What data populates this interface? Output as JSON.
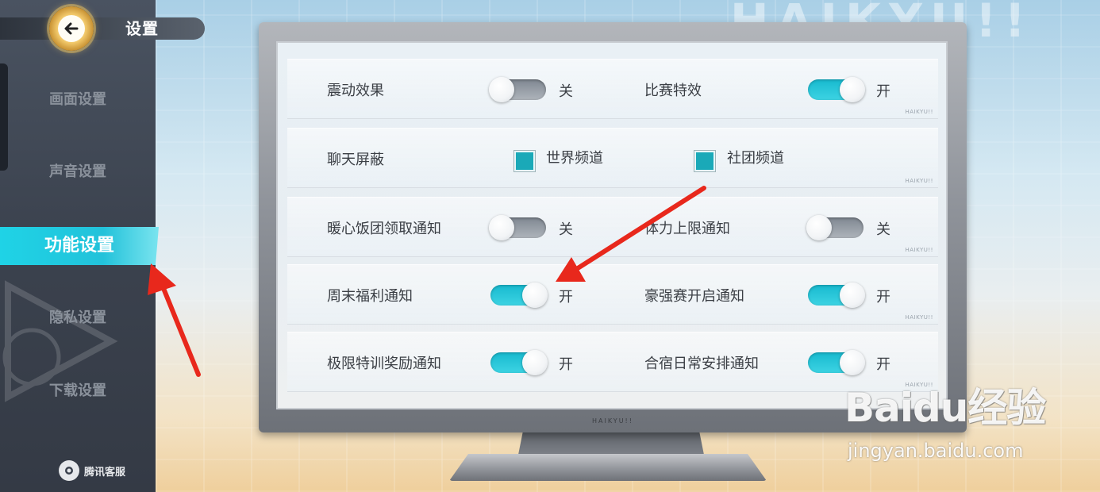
{
  "header": {
    "title": "设置",
    "back_icon": "back-arrow-icon"
  },
  "sidebar": {
    "items": [
      {
        "label": "画面设置",
        "active": false
      },
      {
        "label": "声音设置",
        "active": false
      },
      {
        "label": "功能设置",
        "active": true
      },
      {
        "label": "隐私设置",
        "active": false
      },
      {
        "label": "下载设置",
        "active": false
      }
    ],
    "support_label": "腾讯客服"
  },
  "brand_mark": "HAIKYU!!",
  "settings": {
    "rows": [
      {
        "left": {
          "label": "震动效果",
          "control": "toggle",
          "on": false,
          "state": "关"
        },
        "right": {
          "label": "比赛特效",
          "control": "toggle",
          "on": true,
          "state": "开"
        }
      },
      {
        "left": {
          "label": "聊天屏蔽",
          "control": "none"
        },
        "options": [
          {
            "label": "世界频道",
            "checked": true
          },
          {
            "label": "社团频道",
            "checked": true
          }
        ]
      },
      {
        "left": {
          "label": "暖心饭团领取通知",
          "control": "toggle",
          "on": false,
          "state": "关"
        },
        "right": {
          "label": "体力上限通知",
          "control": "toggle",
          "on": false,
          "state": "关"
        }
      },
      {
        "left": {
          "label": "周末福利通知",
          "control": "toggle",
          "on": true,
          "state": "开"
        },
        "right": {
          "label": "豪强赛开启通知",
          "control": "toggle",
          "on": true,
          "state": "开"
        }
      },
      {
        "left": {
          "label": "极限特训奖励通知",
          "control": "toggle",
          "on": true,
          "state": "开"
        },
        "right": {
          "label": "合宿日常安排通知",
          "control": "toggle",
          "on": true,
          "state": "开"
        }
      }
    ]
  },
  "watermark": {
    "main": "Baidu经验",
    "url": "jingyan.baidu.com"
  },
  "colors": {
    "accent": "#1fd3e6",
    "toggle_on": "#17b9cf",
    "toggle_off": "#8a929b",
    "annotation_arrow": "#e8281c"
  }
}
